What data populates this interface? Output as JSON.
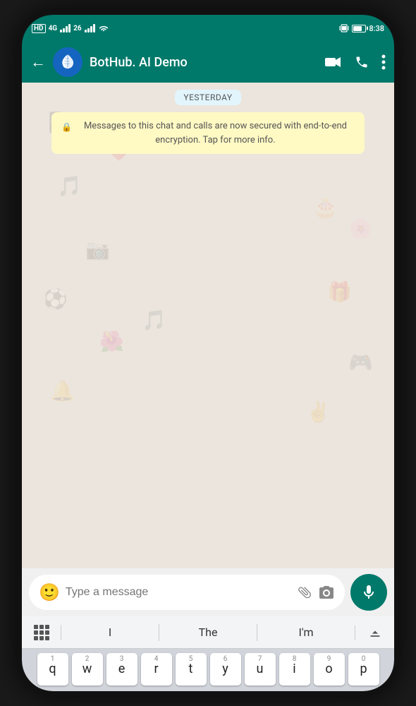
{
  "statusBar": {
    "leftIcons": [
      "HD",
      "4G",
      "26",
      "wifi"
    ],
    "time": "8:38",
    "battery": "70"
  },
  "header": {
    "backLabel": "←",
    "contactName": "BotHub. AI Demo",
    "videoCallIcon": "video-camera",
    "callIcon": "phone",
    "moreIcon": "dots-vertical"
  },
  "chat": {
    "dateBadge": "YESTERDAY",
    "encryptionNotice": "Messages to this chat and calls are now secured with end-to-end encryption. Tap for more info."
  },
  "inputArea": {
    "placeholder": "Type a message"
  },
  "keyboard": {
    "suggestions": [
      "I",
      "The",
      "I'm"
    ],
    "rows": [
      [
        {
          "num": "1",
          "letter": "q"
        },
        {
          "num": "2",
          "letter": "w"
        },
        {
          "num": "3",
          "letter": "e"
        },
        {
          "num": "4",
          "letter": "r"
        },
        {
          "num": "5",
          "letter": "t"
        },
        {
          "num": "6",
          "letter": "y"
        },
        {
          "num": "7",
          "letter": "u"
        },
        {
          "num": "8",
          "letter": "i"
        },
        {
          "num": "9",
          "letter": "o"
        },
        {
          "num": "0",
          "letter": "p"
        }
      ]
    ]
  }
}
